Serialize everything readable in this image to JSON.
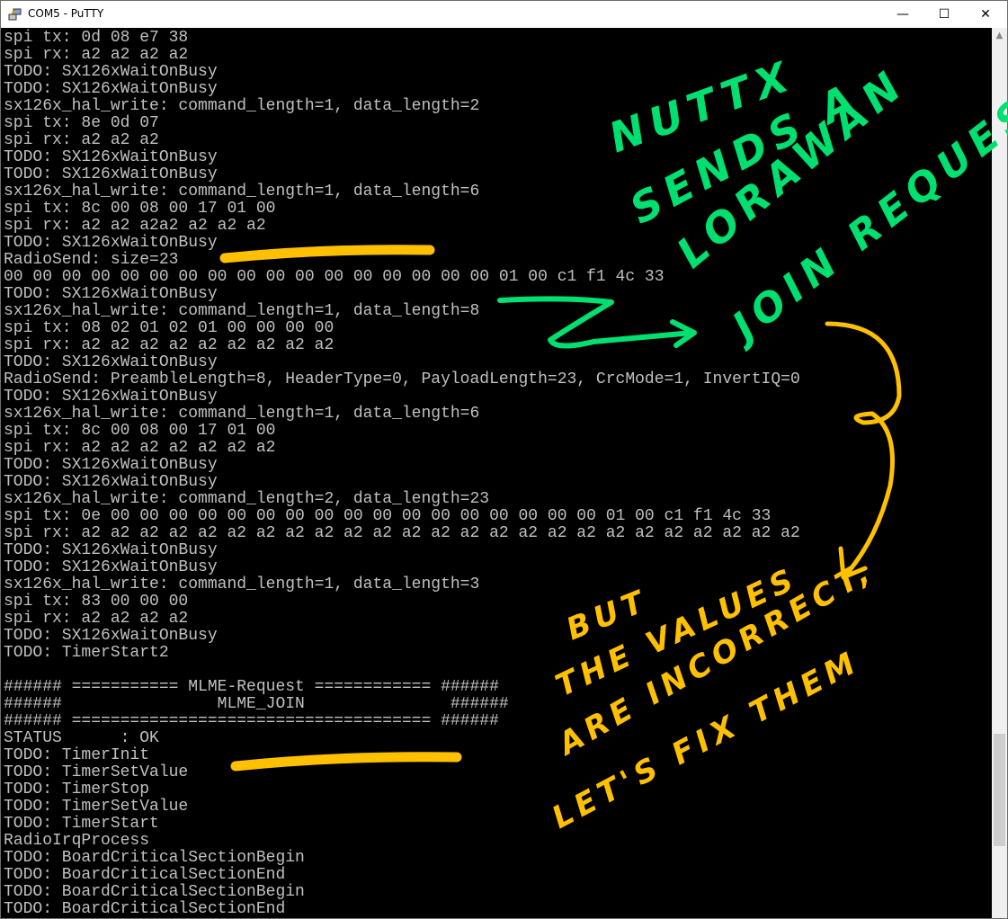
{
  "window": {
    "title": "COM5 - PuTTY",
    "controls": {
      "minimize": "—",
      "maximize": "☐",
      "close": "✕"
    }
  },
  "terminal": {
    "lines": [
      "spi tx: 0d 08 e7 38",
      "spi rx: a2 a2 a2 a2",
      "TODO: SX126xWaitOnBusy",
      "TODO: SX126xWaitOnBusy",
      "sx126x_hal_write: command_length=1, data_length=2",
      "spi tx: 8e 0d 07",
      "spi rx: a2 a2 a2",
      "TODO: SX126xWaitOnBusy",
      "TODO: SX126xWaitOnBusy",
      "sx126x_hal_write: command_length=1, data_length=6",
      "spi tx: 8c 00 08 00 17 01 00",
      "spi rx: a2 a2 a2a2 a2 a2 a2",
      "TODO: SX126xWaitOnBusy",
      "RadioSend: size=23",
      "00 00 00 00 00 00 00 00 00 00 00 00 00 00 00 00 00 01 00 c1 f1 4c 33",
      "TODO: SX126xWaitOnBusy",
      "sx126x_hal_write: command_length=1, data_length=8",
      "spi tx: 08 02 01 02 01 00 00 00 00",
      "spi rx: a2 a2 a2 a2 a2 a2 a2 a2 a2",
      "TODO: SX126xWaitOnBusy",
      "RadioSend: PreambleLength=8, HeaderType=0, PayloadLength=23, CrcMode=1, InvertIQ=0",
      "TODO: SX126xWaitOnBusy",
      "sx126x_hal_write: command_length=1, data_length=6",
      "spi tx: 8c 00 08 00 17 01 00",
      "spi rx: a2 a2 a2 a2 a2 a2 a2",
      "TODO: SX126xWaitOnBusy",
      "TODO: SX126xWaitOnBusy",
      "sx126x_hal_write: command_length=2, data_length=23",
      "spi tx: 0e 00 00 00 00 00 00 00 00 00 00 00 00 00 00 00 00 00 01 00 c1 f1 4c 33",
      "spi rx: a2 a2 a2 a2 a2 a2 a2 a2 a2 a2 a2 a2 a2 a2 a2 a2 a2 a2 a2 a2 a2 a2 a2 a2 a2",
      "TODO: SX126xWaitOnBusy",
      "TODO: SX126xWaitOnBusy",
      "sx126x_hal_write: command_length=1, data_length=3",
      "spi tx: 83 00 00 00",
      "spi rx: a2 a2 a2 a2",
      "TODO: SX126xWaitOnBusy",
      "TODO: TimerStart2",
      "",
      "###### =========== MLME-Request ============ ######",
      "######                MLME_JOIN               ######",
      "###### ===================================== ######",
      "STATUS      : OK",
      "TODO: TimerInit",
      "TODO: TimerSetValue",
      "TODO: TimerStop",
      "TODO: TimerSetValue",
      "TODO: TimerStart",
      "RadioIrqProcess",
      "TODO: BoardCriticalSectionBegin",
      "TODO: BoardCriticalSectionEnd",
      "TODO: BoardCriticalSectionBegin",
      "TODO: BoardCriticalSectionEnd"
    ]
  },
  "annotations": {
    "green": [
      "NUTTX",
      "SENDS A",
      "LORAWAN",
      "JOIN REQUEST"
    ],
    "yellow": [
      "BUT",
      "THE VALUES",
      "ARE INCORRECT,",
      "LET'S FIX THEM"
    ],
    "green_color": "#00e070",
    "yellow_color": "#ffc000"
  },
  "colors": {
    "terminal_bg": "#000000",
    "terminal_fg": "#c0c0c0"
  }
}
